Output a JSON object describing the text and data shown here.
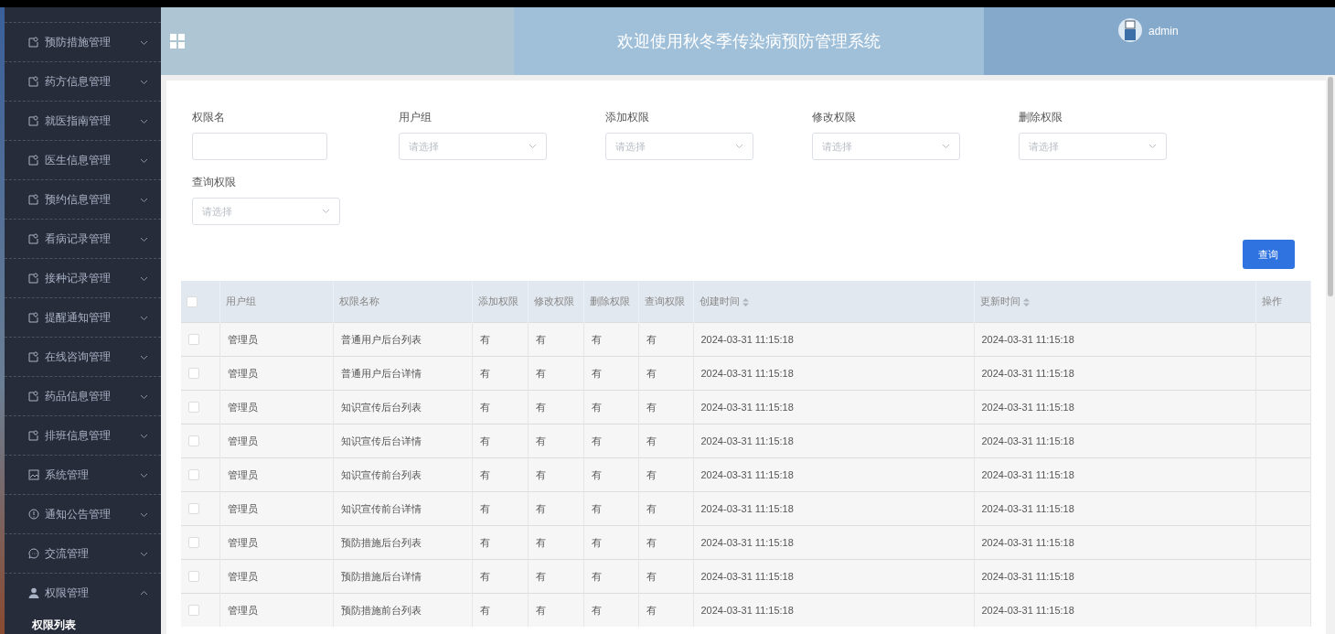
{
  "sidebar": {
    "items": [
      {
        "label": "预防措施管理",
        "kind": "doc",
        "expanded": false
      },
      {
        "label": "药方信息管理",
        "kind": "doc",
        "expanded": false
      },
      {
        "label": "就医指南管理",
        "kind": "doc",
        "expanded": false
      },
      {
        "label": "医生信息管理",
        "kind": "doc",
        "expanded": false
      },
      {
        "label": "预约信息管理",
        "kind": "doc",
        "expanded": false
      },
      {
        "label": "看病记录管理",
        "kind": "doc",
        "expanded": false
      },
      {
        "label": "接种记录管理",
        "kind": "doc",
        "expanded": false
      },
      {
        "label": "提醒通知管理",
        "kind": "doc",
        "expanded": false
      },
      {
        "label": "在线咨询管理",
        "kind": "doc",
        "expanded": false
      },
      {
        "label": "药品信息管理",
        "kind": "doc",
        "expanded": false
      },
      {
        "label": "排班信息管理",
        "kind": "doc",
        "expanded": false
      },
      {
        "label": "系统管理",
        "kind": "image",
        "expanded": false
      },
      {
        "label": "通知公告管理",
        "kind": "info",
        "expanded": false
      },
      {
        "label": "交流管理",
        "kind": "chat",
        "expanded": false
      },
      {
        "label": "权限管理",
        "kind": "user",
        "expanded": true,
        "children": [
          {
            "label": "权限列表"
          }
        ]
      }
    ]
  },
  "header": {
    "title": "欢迎使用秋冬季传染病预防管理系统",
    "user": "admin"
  },
  "filters": [
    {
      "label": "权限名",
      "kind": "text"
    },
    {
      "label": "用户组",
      "kind": "select",
      "placeholder": "请选择"
    },
    {
      "label": "添加权限",
      "kind": "select",
      "placeholder": "请选择"
    },
    {
      "label": "修改权限",
      "kind": "select",
      "placeholder": "请选择"
    },
    {
      "label": "删除权限",
      "kind": "select",
      "placeholder": "请选择"
    },
    {
      "label": "查询权限",
      "kind": "select",
      "placeholder": "请选择"
    }
  ],
  "search_button": "查询",
  "table": {
    "all_selected": false,
    "columns": [
      {
        "label": "用户组",
        "sortable": false
      },
      {
        "label": "权限名称",
        "sortable": false
      },
      {
        "label": "添加权限",
        "sortable": false
      },
      {
        "label": "修改权限",
        "sortable": false
      },
      {
        "label": "删除权限",
        "sortable": false
      },
      {
        "label": "查询权限",
        "sortable": false
      },
      {
        "label": "创建时间",
        "sortable": true
      },
      {
        "label": "更新时间",
        "sortable": true
      },
      {
        "label": "操作",
        "sortable": false
      }
    ],
    "rows": [
      {
        "selected": false,
        "cells": [
          "管理员",
          "普通用户后台列表",
          "有",
          "有",
          "有",
          "有",
          "2024-03-31 11:15:18",
          "2024-03-31 11:15:18"
        ]
      },
      {
        "selected": false,
        "cells": [
          "管理员",
          "普通用户后台详情",
          "有",
          "有",
          "有",
          "有",
          "2024-03-31 11:15:18",
          "2024-03-31 11:15:18"
        ]
      },
      {
        "selected": false,
        "cells": [
          "管理员",
          "知识宣传后台列表",
          "有",
          "有",
          "有",
          "有",
          "2024-03-31 11:15:18",
          "2024-03-31 11:15:18"
        ]
      },
      {
        "selected": false,
        "cells": [
          "管理员",
          "知识宣传后台详情",
          "有",
          "有",
          "有",
          "有",
          "2024-03-31 11:15:18",
          "2024-03-31 11:15:18"
        ]
      },
      {
        "selected": false,
        "cells": [
          "管理员",
          "知识宣传前台列表",
          "有",
          "有",
          "有",
          "有",
          "2024-03-31 11:15:18",
          "2024-03-31 11:15:18"
        ]
      },
      {
        "selected": false,
        "cells": [
          "管理员",
          "知识宣传前台详情",
          "有",
          "有",
          "有",
          "有",
          "2024-03-31 11:15:18",
          "2024-03-31 11:15:18"
        ]
      },
      {
        "selected": false,
        "cells": [
          "管理员",
          "预防措施后台列表",
          "有",
          "有",
          "有",
          "有",
          "2024-03-31 11:15:18",
          "2024-03-31 11:15:18"
        ]
      },
      {
        "selected": false,
        "cells": [
          "管理员",
          "预防措施后台详情",
          "有",
          "有",
          "有",
          "有",
          "2024-03-31 11:15:18",
          "2024-03-31 11:15:18"
        ]
      },
      {
        "selected": false,
        "cells": [
          "管理员",
          "预防措施前台列表",
          "有",
          "有",
          "有",
          "有",
          "2024-03-31 11:15:18",
          "2024-03-31 11:15:18"
        ]
      }
    ]
  }
}
